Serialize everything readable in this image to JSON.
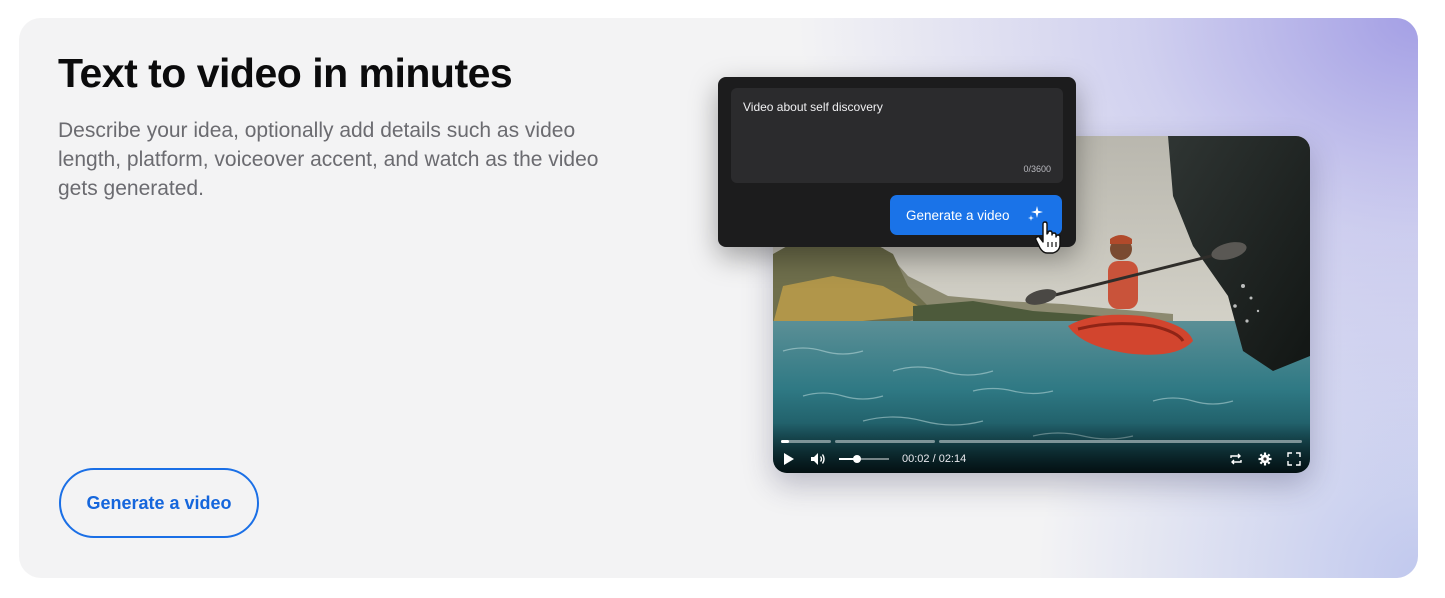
{
  "hero": {
    "title": "Text to video in minutes",
    "description": "Describe your idea, optionally add details such as video length, platform, voiceover accent, and watch as the video gets generated.",
    "cta_label": "Generate a video"
  },
  "prompt_panel": {
    "input_value": "Video about self discovery",
    "char_counter": "0/3600",
    "button_label": "Generate a video",
    "button_icon": "sparkle-icon"
  },
  "video_player": {
    "current_time": "00:02",
    "total_time": "02:14",
    "time_display": "00:02 / 02:14",
    "progress_fraction": 0.015,
    "buffered_fraction": 0.05,
    "volume_fraction": 0.35,
    "icons": [
      "play-icon",
      "volume-icon",
      "repeat-icon",
      "settings-icon",
      "fullscreen-icon"
    ]
  },
  "colors": {
    "accent": "#1a73e8",
    "card_background": "#f3f3f4",
    "gradient": "#a09be4",
    "panel_background": "#1c1c1d"
  }
}
